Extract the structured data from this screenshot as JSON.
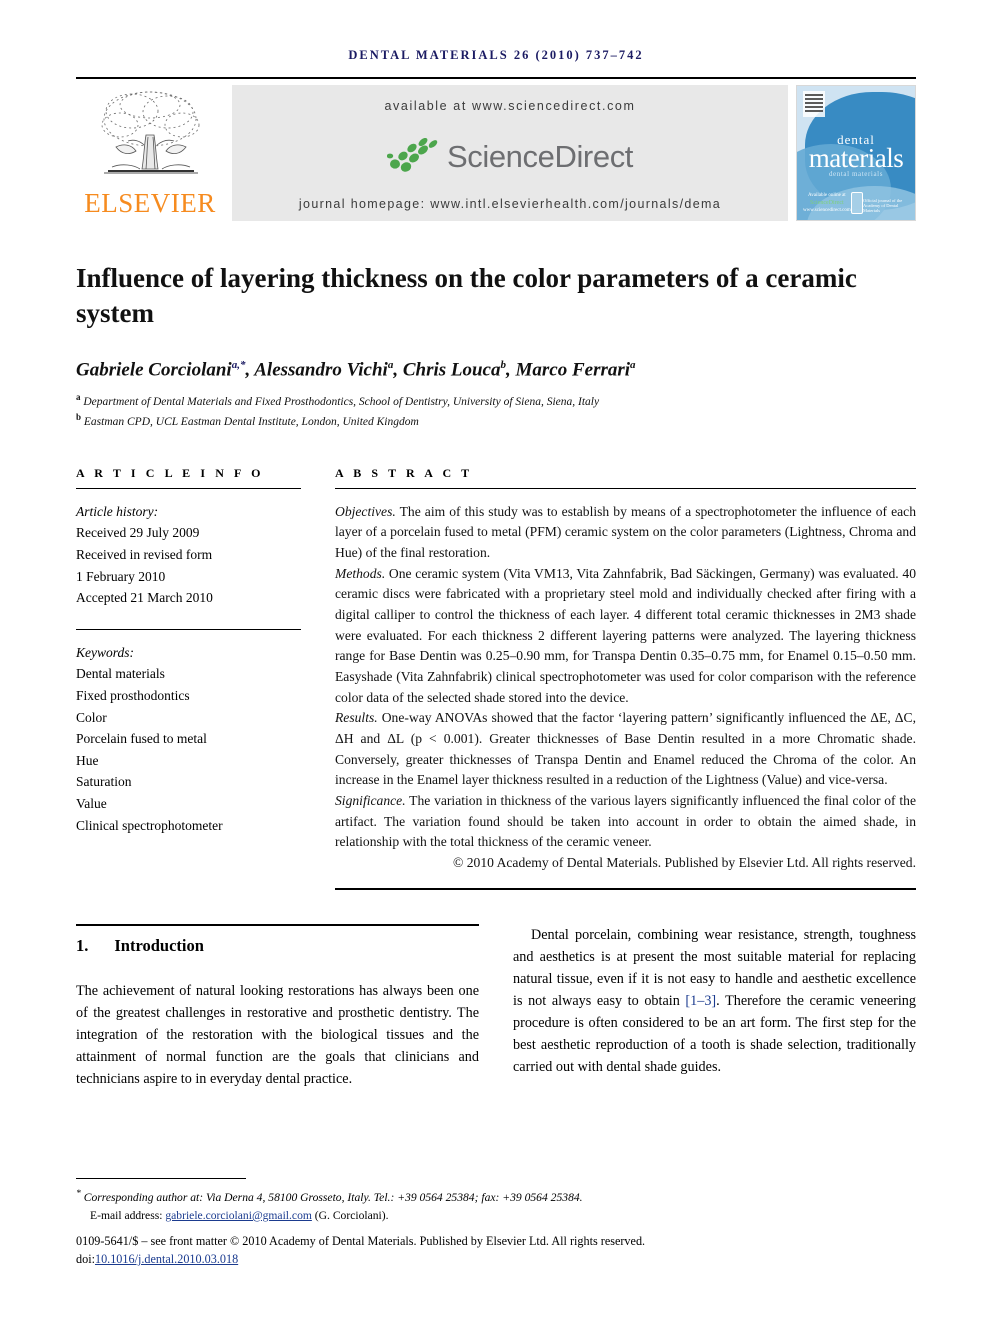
{
  "running_head": "DENTAL MATERIALS 26 (2010) 737–742",
  "masthead": {
    "publisher_word": "ELSEVIER",
    "available_at": "available at www.sciencedirect.com",
    "sciencedirect_word": "ScienceDirect",
    "journal_homepage": "journal homepage: www.intl.elsevierhealth.com/journals/dema",
    "cover": {
      "title_line1": "dental",
      "title_line2": "materials",
      "subtitle": "dental materials",
      "sd_label_small": "Available online at",
      "sd_label_word": "ScienceDirect",
      "sd_label_url": "www.sciencedirect.com",
      "side_text": "Official journal of the Academy of Dental Materials"
    }
  },
  "article": {
    "title": "Influence of layering thickness on the color parameters of a ceramic system",
    "authors": [
      {
        "name": "Gabriele Corciolani",
        "marks": "a,*"
      },
      {
        "name": "Alessandro Vichi",
        "marks": "a"
      },
      {
        "name": "Chris Louca",
        "marks": "b"
      },
      {
        "name": "Marco Ferrari",
        "marks": "a"
      }
    ],
    "affiliations": [
      {
        "mark": "a",
        "text": "Department of Dental Materials and Fixed Prosthodontics, School of Dentistry, University of Siena, Siena, Italy"
      },
      {
        "mark": "b",
        "text": "Eastman CPD, UCL Eastman Dental Institute, London, United Kingdom"
      }
    ]
  },
  "article_info": {
    "heading": "A R T I C L E   I N F O",
    "history_label": "Article history:",
    "history": [
      "Received 29 July 2009",
      "Received in revised form",
      "1 February 2010",
      "Accepted 21 March 2010"
    ],
    "keywords_label": "Keywords:",
    "keywords": [
      "Dental materials",
      "Fixed prosthodontics",
      "Color",
      "Porcelain fused to metal",
      "Hue",
      "Saturation",
      "Value",
      "Clinical spectrophotometer"
    ]
  },
  "abstract": {
    "heading": "A B S T R A C T",
    "objectives_label": "Objectives.",
    "objectives_text": " The aim of this study was to establish by means of a spectrophotometer the influence of each layer of a porcelain fused to metal (PFM) ceramic system on the color parameters (Lightness, Chroma and Hue) of the final restoration.",
    "methods_label": "Methods.",
    "methods_text": " One ceramic system (Vita VM13, Vita Zahnfabrik, Bad Säckingen, Germany) was evaluated. 40 ceramic discs were fabricated with a proprietary steel mold and individually checked after firing with a digital calliper to control the thickness of each layer. 4 different total ceramic thicknesses in 2M3 shade were evaluated. For each thickness 2 different layering patterns were analyzed. The layering thickness range for Base Dentin was 0.25–0.90 mm, for Transpa Dentin 0.35–0.75 mm, for Enamel 0.15–0.50 mm. Easyshade (Vita Zahnfabrik) clinical spectrophotometer was used for color comparison with the reference color data of the selected shade stored into the device.",
    "results_label": "Results.",
    "results_text": " One-way ANOVAs showed that the factor ‘layering pattern’ significantly influenced the ΔE, ΔC, ΔH and ΔL (p < 0.001). Greater thicknesses of Base Dentin resulted in a more Chromatic shade. Conversely, greater thicknesses of Transpa Dentin and Enamel reduced the Chroma of the color. An increase in the Enamel layer thickness resulted in a reduction of the Lightness (Value) and vice-versa.",
    "significance_label": "Significance.",
    "significance_text": " The variation in thickness of the various layers significantly influenced the final color of the artifact. The variation found should be taken into account in order to obtain the aimed shade, in relationship with the total thickness of the ceramic veneer.",
    "copyright": "© 2010 Academy of Dental Materials. Published by Elsevier Ltd. All rights reserved."
  },
  "introduction": {
    "number": "1.",
    "heading": "Introduction",
    "left_paragraph": "The achievement of natural looking restorations has always been one of the greatest challenges in restorative and prosthetic dentistry. The integration of the restoration with the biological tissues and the attainment of normal function are the goals that clinicians and technicians aspire to in everyday dental practice.",
    "right_paragraph_part1": "Dental porcelain, combining wear resistance, strength, toughness and aesthetics is at present the most suitable material for replacing natural tissue, even if it is not easy to handle and aesthetic excellence is not always easy to obtain ",
    "right_reference": "[1–3]",
    "right_paragraph_part2": ". Therefore the ceramic veneering procedure is often considered to be an art form. The first step for the best aesthetic reproduction of a tooth is shade selection, traditionally carried out with dental shade guides."
  },
  "footer": {
    "corresponding_marker": "*",
    "corresponding_label": "Corresponding author at:",
    "corresponding_text": " Via Derna 4, 58100 Grosseto, Italy. Tel.: +39 0564 25384; fax: +39 0564 25384.",
    "email_label": "E-mail address:",
    "email": "gabriele.corciolani@gmail.com",
    "email_suffix": " (G. Corciolani).",
    "issn_line": "0109-5641/$ – see front matter © 2010 Academy of Dental Materials. Published by Elsevier Ltd. All rights reserved.",
    "doi_label": "doi:",
    "doi_value": "10.1016/j.dental.2010.03.018"
  },
  "colors": {
    "running_head": "#1b1b63",
    "elsevier_orange": "#F68B1F",
    "sciencedirect_green": "#4CA64C",
    "sciencedirect_gray": "#6d6e71",
    "banner_bg": "#e8e8e8",
    "link_blue": "#1b3b8f",
    "cover_blue": "#2f86c0"
  }
}
